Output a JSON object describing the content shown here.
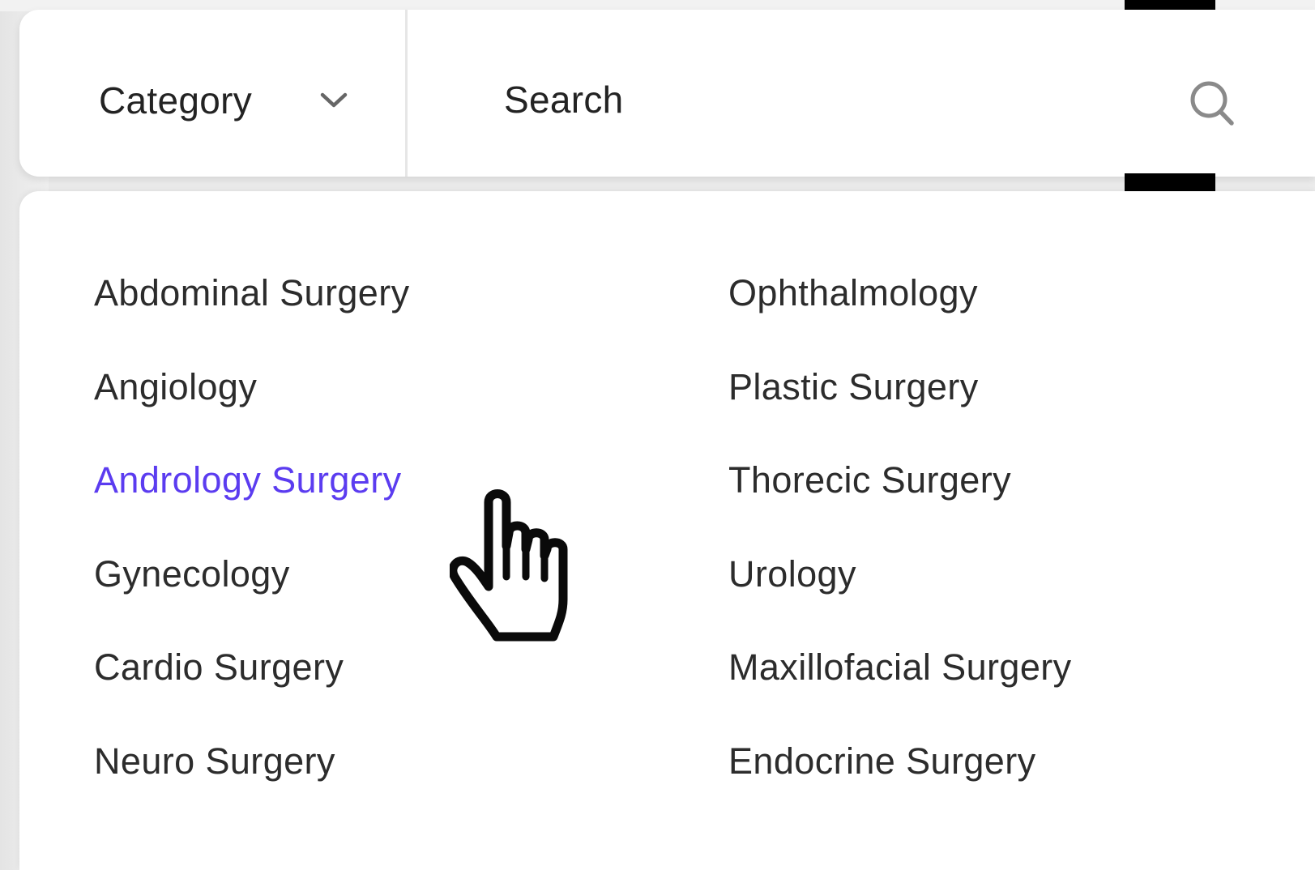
{
  "search_bar": {
    "category_label": "Category",
    "search_placeholder": "Search"
  },
  "dropdown": {
    "left_column": [
      {
        "label": "Abdominal Surgery",
        "active": false
      },
      {
        "label": "Angiology",
        "active": false
      },
      {
        "label": "Andrology Surgery",
        "active": true
      },
      {
        "label": "Gynecology",
        "active": false
      },
      {
        "label": "Cardio Surgery",
        "active": false
      },
      {
        "label": "Neuro Surgery",
        "active": false
      }
    ],
    "right_column": [
      {
        "label": "Ophthalmology",
        "active": false
      },
      {
        "label": "Plastic Surgery",
        "active": false
      },
      {
        "label": "Thorecic Surgery",
        "active": false
      },
      {
        "label": "Urology",
        "active": false
      },
      {
        "label": "Maxillofacial Surgery",
        "active": false
      },
      {
        "label": "Endocrine Surgery",
        "active": false
      }
    ]
  },
  "colors": {
    "active_item": "#5b3cf0",
    "text": "#2c2c2c"
  },
  "icons": [
    "chevron-down-icon",
    "search-icon",
    "hand-cursor-icon"
  ]
}
